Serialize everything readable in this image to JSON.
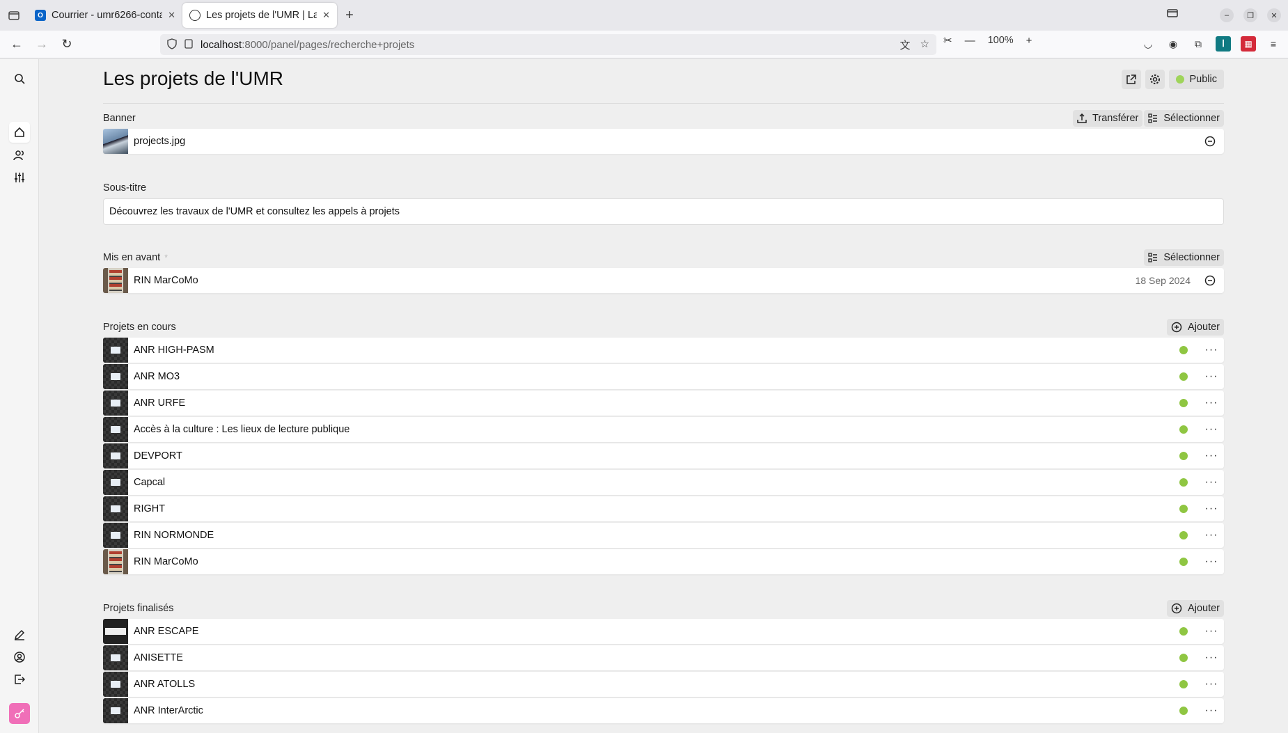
{
  "browser": {
    "tabs": [
      {
        "title": "Courrier - umr6266-conta",
        "active": false
      },
      {
        "title": "Les projets de l'UMR | Lal",
        "active": true
      }
    ],
    "url_host": "localhost",
    "url_rest": ":8000/panel/pages/recherche+projets",
    "zoom": "100%"
  },
  "page": {
    "title": "Les projets de l'UMR",
    "status": "Public"
  },
  "banner": {
    "label": "Banner",
    "upload_label": "Transférer",
    "select_label": "Sélectionner",
    "file": "projects.jpg"
  },
  "subtitle": {
    "label": "Sous-titre",
    "value": "Découvrez les travaux de l'UMR et consultez les appels à projets"
  },
  "featured": {
    "label": "Mis en avant",
    "required_mark": "*",
    "select_label": "Sélectionner",
    "item": {
      "title": "RIN MarCoMo",
      "date": "18 Sep 2024"
    }
  },
  "current_projects": {
    "label": "Projets en cours",
    "add_label": "Ajouter",
    "items": [
      {
        "title": "ANR HIGH-PASM",
        "thumb": "book"
      },
      {
        "title": "ANR MO3",
        "thumb": "book"
      },
      {
        "title": "ANR URFE",
        "thumb": "book"
      },
      {
        "title": "Accès à la culture : Les lieux de lecture publique",
        "thumb": "book"
      },
      {
        "title": "DEVPORT",
        "thumb": "book"
      },
      {
        "title": "Capcal",
        "thumb": "book"
      },
      {
        "title": "RIGHT",
        "thumb": "book"
      },
      {
        "title": "RIN NORMONDE",
        "thumb": "book"
      },
      {
        "title": "RIN MarCoMo",
        "thumb": "marcomo"
      }
    ]
  },
  "finished_projects": {
    "label": "Projets finalisés",
    "add_label": "Ajouter",
    "items": [
      {
        "title": "ANR ESCAPE",
        "thumb": "escape"
      },
      {
        "title": "ANISETTE",
        "thumb": "book"
      },
      {
        "title": "ANR ATOLLS",
        "thumb": "book"
      },
      {
        "title": "ANR InterArctic",
        "thumb": "book"
      }
    ]
  },
  "colors": {
    "status_green": "#8fc642",
    "accent_pink": "#f06fb8"
  },
  "icons": [
    "search-icon",
    "home-icon",
    "users-icon",
    "settings-sliders-icon",
    "edit-icon",
    "account-icon",
    "logout-icon",
    "key-icon"
  ]
}
